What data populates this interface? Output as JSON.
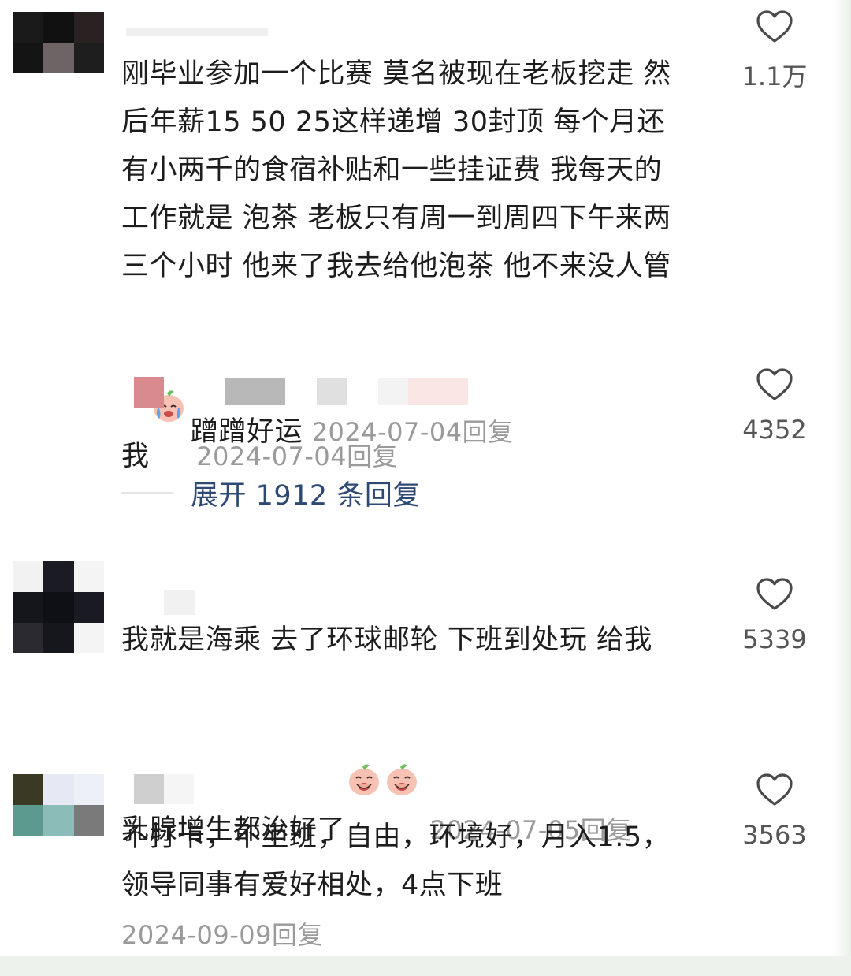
{
  "comments": [
    {
      "text": "刚毕业参加一个比赛 莫名被现在老板挖走 然\n后年薪15 50 25这样递增 30封顶 每个月还\n有小两千的食宿补贴和一些挂证费 我每天的\n工作就是 泡茶 老板只有周一到周四下午来两\n三个小时 他来了我去给他泡茶 他不来没人管\n我",
      "emoji": [
        "crying-peach-emoji"
      ],
      "date": "2024-07-04",
      "reply_label": "回复",
      "likes": "1.1万"
    },
    {
      "text": "我就是海乘 去了环球邮轮 下班到处玩 给我\n乳腺增生都治好了",
      "emoji": [
        "snickering-peach-emoji",
        "snickering-peach-emoji"
      ],
      "date": "2024-07-05",
      "reply_label": "回复",
      "likes": "5339"
    },
    {
      "text": "不打卡，不坐班，自由，环境好，月入1.5，\n领导同事有爱好相处，4点下班",
      "date": "2024-09-09",
      "reply_label": "回复",
      "likes": "3563"
    }
  ],
  "sub_reply": {
    "text": "蹭蹭好运",
    "date": "2024-07-04",
    "reply_label": "回复",
    "likes": "4352"
  },
  "expand": {
    "label": "展开 1912 条回复"
  },
  "colors": {
    "link": "#2e4a74",
    "meta": "#9a9a9a"
  },
  "icons": {
    "like": "heart-outline-icon"
  }
}
